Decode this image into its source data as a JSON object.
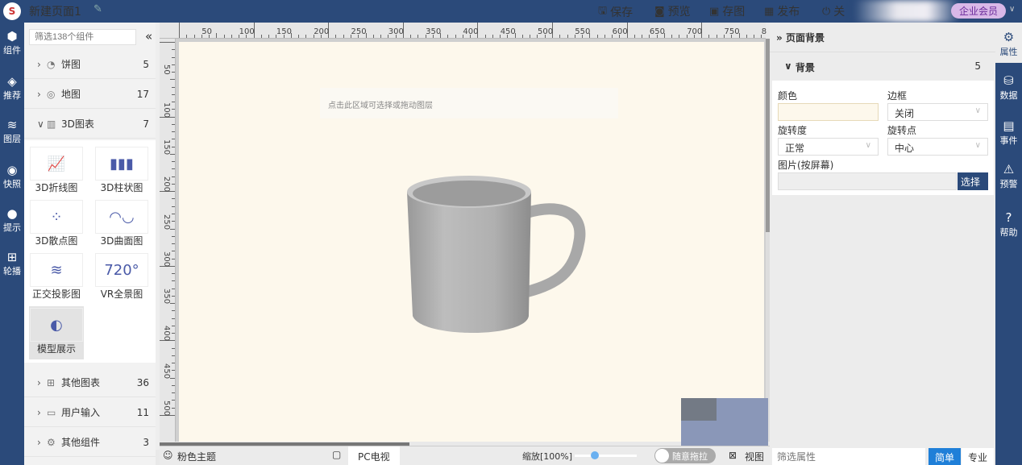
{
  "header": {
    "title": "新建页面1",
    "logo": "S",
    "actions": [
      {
        "icon": "save-icon",
        "glyph": "🖫",
        "label": "保存"
      },
      {
        "icon": "preview-icon",
        "glyph": "◙",
        "label": "预览"
      },
      {
        "icon": "image-icon",
        "glyph": "▣",
        "label": "存图"
      },
      {
        "icon": "publish-icon",
        "glyph": "▦",
        "label": "发布"
      },
      {
        "icon": "power-icon",
        "glyph": "⏻",
        "label": "关"
      }
    ],
    "member": "企业会员"
  },
  "left_nav": [
    {
      "icon": "component-icon",
      "glyph": "⬢",
      "label": "组件"
    },
    {
      "icon": "recommend-icon",
      "glyph": "◈",
      "label": "推荐"
    },
    {
      "icon": "layers-icon",
      "glyph": "≋",
      "label": "图层"
    },
    {
      "icon": "camera-icon",
      "glyph": "◉",
      "label": "快照"
    },
    {
      "icon": "tip-icon",
      "glyph": "●",
      "label": "提示"
    },
    {
      "icon": "carousel-icon",
      "glyph": "⊞",
      "label": "轮播"
    }
  ],
  "sidebar": {
    "filter_placeholder": "筛选138个组件",
    "categories_top": [
      {
        "label": "饼图",
        "count": "5",
        "icon": "pie-icon",
        "glyph": "◔",
        "open": false
      },
      {
        "label": "地图",
        "count": "17",
        "icon": "map-icon",
        "glyph": "◎",
        "open": false
      },
      {
        "label": "3D图表",
        "count": "7",
        "icon": "cube-icon",
        "glyph": "▥",
        "open": true
      }
    ],
    "tiles": [
      {
        "label": "3D折线图",
        "glyph": "📈"
      },
      {
        "label": "3D柱状图",
        "glyph": "▮▮▮"
      },
      {
        "label": "3D散点图",
        "glyph": "⁘"
      },
      {
        "label": "3D曲面图",
        "glyph": "◠◡"
      },
      {
        "label": "正交投影图",
        "glyph": "≋"
      },
      {
        "label": "VR全景图",
        "glyph": "720°"
      },
      {
        "label": "模型展示",
        "glyph": "◐",
        "selected": true
      }
    ],
    "categories_bottom": [
      {
        "label": "其他图表",
        "count": "36",
        "icon": "chart-icon",
        "glyph": "⊞"
      },
      {
        "label": "用户输入",
        "count": "11",
        "icon": "input-icon",
        "glyph": "▭"
      },
      {
        "label": "其他组件",
        "count": "3",
        "icon": "widget-icon",
        "glyph": "⚙"
      }
    ]
  },
  "ruler": {
    "h": [
      "50",
      "100",
      "150",
      "200",
      "250",
      "300",
      "350",
      "400",
      "450",
      "500",
      "550",
      "600",
      "650",
      "700",
      "750",
      "8"
    ],
    "v": [
      "50",
      "100",
      "150",
      "200",
      "250",
      "300",
      "350",
      "400",
      "450",
      "500"
    ]
  },
  "canvas": {
    "hint": "点击此区域可选择或拖动图层",
    "background": "#fdf8ec"
  },
  "bottom": {
    "theme": "粉色主题",
    "device": "PC电视",
    "zoom": "缩放[100%]",
    "zoom_percent": 100,
    "drag_toggle": "随意拖拉",
    "view": "视图"
  },
  "right_panel": {
    "title": "页面背景",
    "section": "背景",
    "section_count": "5",
    "color_label": "颜色",
    "color_value": "#fdf8ec",
    "border_label": "边框",
    "border_value": "关闭",
    "rotate_label": "旋转度",
    "rotate_value": "正常",
    "pivot_label": "旋转点",
    "pivot_value": "中心",
    "image_label": "图片(按屏幕)",
    "choose": "选择",
    "filter_placeholder": "筛选属性",
    "simple": "简单",
    "pro": "专业"
  },
  "right_nav": [
    {
      "icon": "properties-icon",
      "glyph": "⚙",
      "label": "属性"
    },
    {
      "icon": "data-icon",
      "glyph": "⛁",
      "label": "数据"
    },
    {
      "icon": "event-icon",
      "glyph": "▤",
      "label": "事件"
    },
    {
      "icon": "alarm-icon",
      "glyph": "⚠",
      "label": "预警"
    },
    {
      "icon": "help-icon",
      "glyph": "?",
      "label": "帮助"
    }
  ]
}
